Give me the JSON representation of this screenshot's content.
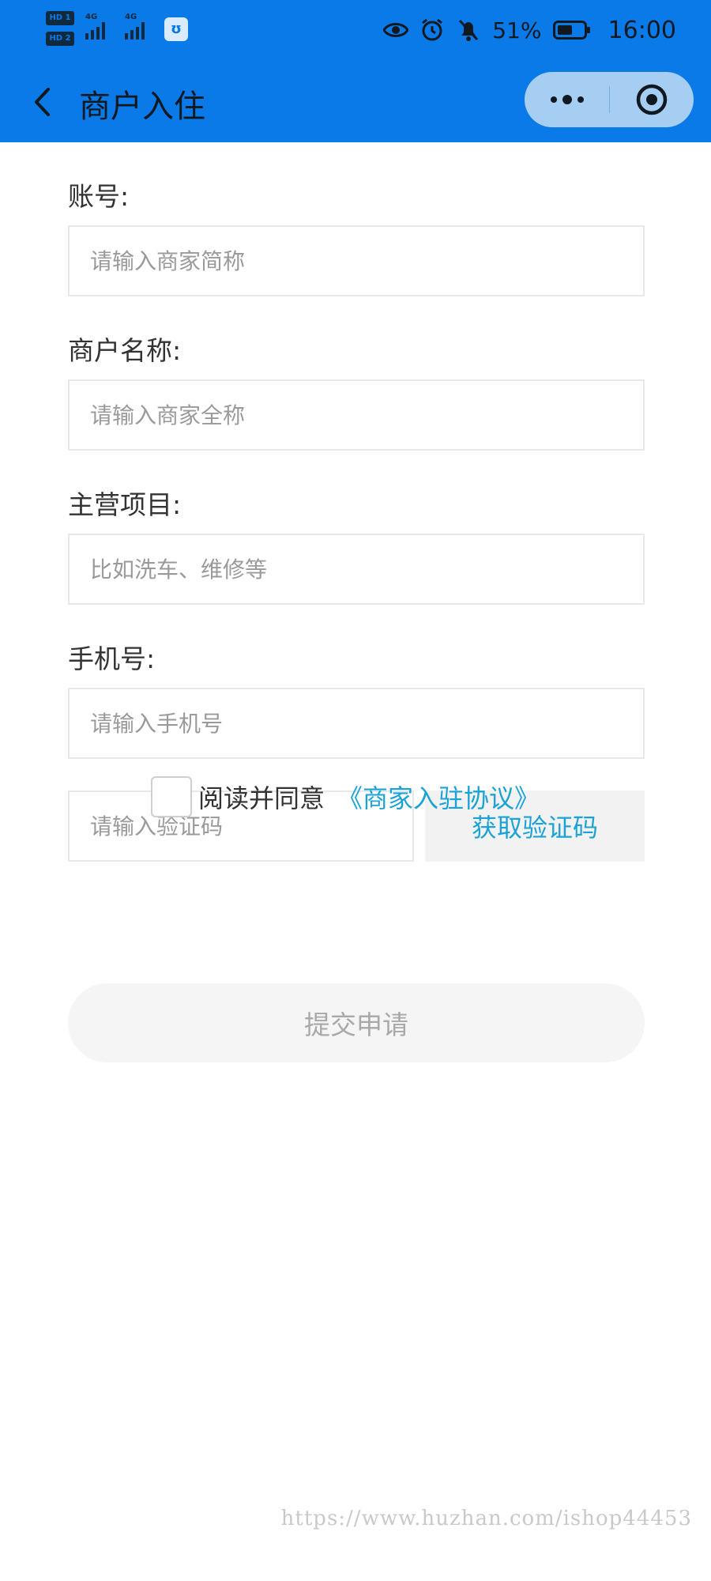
{
  "status_bar": {
    "sim1_label": "HD 1",
    "sim2_label": "HD 2",
    "network1": "4G",
    "network2": "4G",
    "battery_percent": "51%",
    "time": "16:00",
    "icons": [
      "eye-icon",
      "alarm-icon",
      "mute-bell-icon",
      "battery-icon"
    ]
  },
  "nav": {
    "title": "商户入住"
  },
  "form": {
    "account_label": "账号:",
    "account_placeholder": "请输入商家简称",
    "name_label": "商户名称:",
    "name_placeholder": "请输入商家全称",
    "business_label": "主营项目:",
    "business_placeholder": "比如洗车、维修等",
    "phone_label": "手机号:",
    "phone_placeholder": "请输入手机号",
    "code_placeholder": "请输入验证码",
    "get_code_label": "获取验证码",
    "agree_text": "阅读并同意",
    "agreement_link": "《商家入驻协议》",
    "submit_label": "提交申请"
  },
  "colors": {
    "header_bg": "#0a7ae8",
    "link": "#1ba2d6",
    "submit_bg": "#f5f5f5"
  },
  "watermark": "https://www.huzhan.com/ishop44453"
}
